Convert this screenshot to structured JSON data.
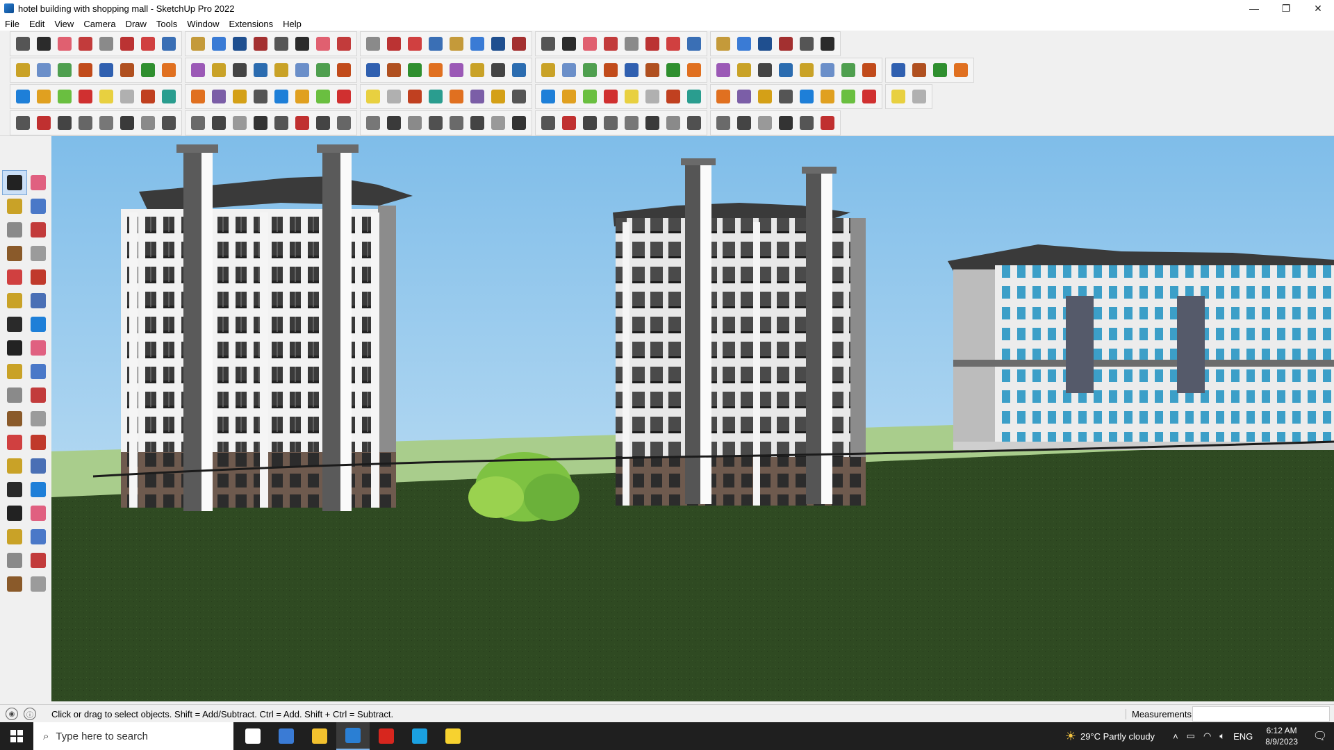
{
  "window": {
    "title": "hotel building with shopping mall - SketchUp Pro 2022",
    "controls": {
      "minimize": "—",
      "restore": "❐",
      "close": "✕"
    }
  },
  "menu": [
    "File",
    "Edit",
    "View",
    "Camera",
    "Draw",
    "Tools",
    "Window",
    "Extensions",
    "Help"
  ],
  "toolbar_rows": [
    {
      "count": 38,
      "palette": [
        "#555555",
        "#2b2b2b",
        "#e06070",
        "#c23b3b",
        "#8a8a8a",
        "#b33",
        "#d04040",
        "#3a6fb5",
        "#c49a3a",
        "#3a7bd5",
        "#1f4f8f",
        "#a33030"
      ]
    },
    {
      "count": 44,
      "palette": [
        "#c9a227",
        "#6b8fc9",
        "#4f9f4f",
        "#c14b1b",
        "#3060b0",
        "#b05020",
        "#2f8f2f",
        "#e07020",
        "#9b59b6",
        "#c9a227",
        "#444444",
        "#2b6cb0"
      ]
    },
    {
      "count": 42,
      "palette": [
        "#1e7fd8",
        "#e0a020",
        "#6abf40",
        "#d03030",
        "#e8d040",
        "#b0b0b0",
        "#c04020",
        "#2a9d8f",
        "#e07020",
        "#7b5ea7",
        "#d4a017",
        "#555555"
      ]
    },
    {
      "count": 38,
      "palette": [
        "#555555",
        "#c03030",
        "#444444",
        "#666666",
        "#777777",
        "#3a3a3a",
        "#8a8a8a",
        "#505050",
        "#6a6a6a",
        "#444444",
        "#999999",
        "#333333"
      ]
    }
  ],
  "left_tools": {
    "count": 36,
    "selected_index": 0,
    "palette": [
      "#222222",
      "#e06080",
      "#c9a227",
      "#4a78c8",
      "#8a8a8a",
      "#c23b3b",
      "#8a5a2a",
      "#9b9b9b",
      "#d04040",
      "#c0392b",
      "#c9a227",
      "#4a6fb5",
      "#2a2a2a",
      "#1e7fd8"
    ]
  },
  "status": {
    "hint": "Click or drag to select objects. Shift = Add/Subtract. Ctrl = Add. Shift + Ctrl = Subtract.",
    "measurements_label": "Measurements",
    "measurements_value": ""
  },
  "taskbar": {
    "search_placeholder": "Type here to search",
    "apps": [
      {
        "name": "task-view",
        "color": "#ffffff",
        "active": false
      },
      {
        "name": "calculator",
        "color": "#3a7bd5",
        "active": false
      },
      {
        "name": "file-explorer",
        "color": "#f2c12e",
        "active": false
      },
      {
        "name": "sketchup",
        "color": "#2a7fd4",
        "active": true
      },
      {
        "name": "acrobat",
        "color": "#d7261e",
        "active": false
      },
      {
        "name": "edge",
        "color": "#1aa0e0",
        "active": false
      },
      {
        "name": "sticky-notes",
        "color": "#f7d22f",
        "active": false
      }
    ],
    "weather": "29°C  Partly cloudy",
    "language": "ENG",
    "time": "6:12 AM",
    "date": "8/9/2023"
  },
  "colors": {
    "sky_top": "#7fbde9",
    "sky_bottom": "#cfe6f5",
    "ground": "#2f4a22",
    "facade_light": "#f2f2f2",
    "facade_dark": "#4a4a4a",
    "base": "#6e5a4e",
    "roof": "#3a3a3a",
    "glass": "#3c9fc8"
  }
}
